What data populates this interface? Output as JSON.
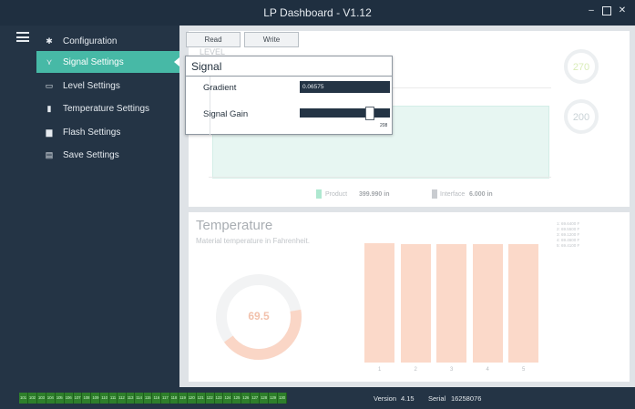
{
  "window": {
    "title": "LP Dashboard - V1.12",
    "minimize_glyph": "–",
    "maximize_glyph": "",
    "close_glyph": "✕"
  },
  "sidebar": {
    "menu_icon": "hamburger-icon",
    "items": [
      {
        "label": "Configuration",
        "icon": "gear-icon",
        "glyph": "✱"
      },
      {
        "label": "Signal Settings",
        "icon": "signal-icon",
        "glyph": "⋎",
        "active": true
      },
      {
        "label": "Level Settings",
        "icon": "level-icon",
        "glyph": "▭"
      },
      {
        "label": "Temperature Settings",
        "icon": "thermometer-icon",
        "glyph": "▮"
      },
      {
        "label": "Flash Settings",
        "icon": "flash-icon",
        "glyph": "▆"
      },
      {
        "label": "Save Settings",
        "icon": "save-icon",
        "glyph": "▤"
      }
    ]
  },
  "toolbar": {
    "read_label": "Read",
    "write_label": "Write"
  },
  "level_panel": {
    "title_fragment": "LEVEL",
    "gauge_top": "270",
    "gauge_bottom": "200",
    "legend": [
      {
        "label": "Product",
        "value": "399.990 in",
        "color": "#aee8d0"
      },
      {
        "label": "Interface",
        "value": "6.000 in",
        "color": "#c9ccd0"
      }
    ]
  },
  "signal_dialog": {
    "title": "Signal",
    "gradient_label": "Gradient",
    "gradient_value": "0.06575",
    "gain_label": "Signal Gain",
    "gain_value": "208"
  },
  "temperature_panel": {
    "title": "Temperature",
    "subtitle": "Material temperature in Fahrenheit.",
    "avg_value": "69.5",
    "legend_lines": [
      "1: 69.6400 F",
      "2: 69.5500 F",
      "3: 69.1200 F",
      "4: 69.4600 F",
      "5: 69.4100 F"
    ],
    "chart_data": {
      "type": "bar",
      "categories": [
        "1",
        "2",
        "3",
        "4",
        "5"
      ],
      "values": [
        69.64,
        69.55,
        69.12,
        69.46,
        69.41
      ],
      "bar_color": "#fbd9c9"
    }
  },
  "statusbar": {
    "ports": [
      "101",
      "102",
      "103",
      "104",
      "105",
      "106",
      "107",
      "108",
      "109",
      "110",
      "111",
      "112",
      "113",
      "114",
      "115",
      "116",
      "117",
      "118",
      "119",
      "120",
      "121",
      "122",
      "123",
      "124",
      "125",
      "126",
      "127",
      "128",
      "129",
      "130"
    ],
    "version_label": "Version",
    "version_value": "4.15",
    "serial_label": "Serial",
    "serial_value": "16258076"
  },
  "colors": {
    "sidebar_bg": "#243445",
    "accent": "#47b9a6",
    "port_green": "#2e7f2b"
  }
}
